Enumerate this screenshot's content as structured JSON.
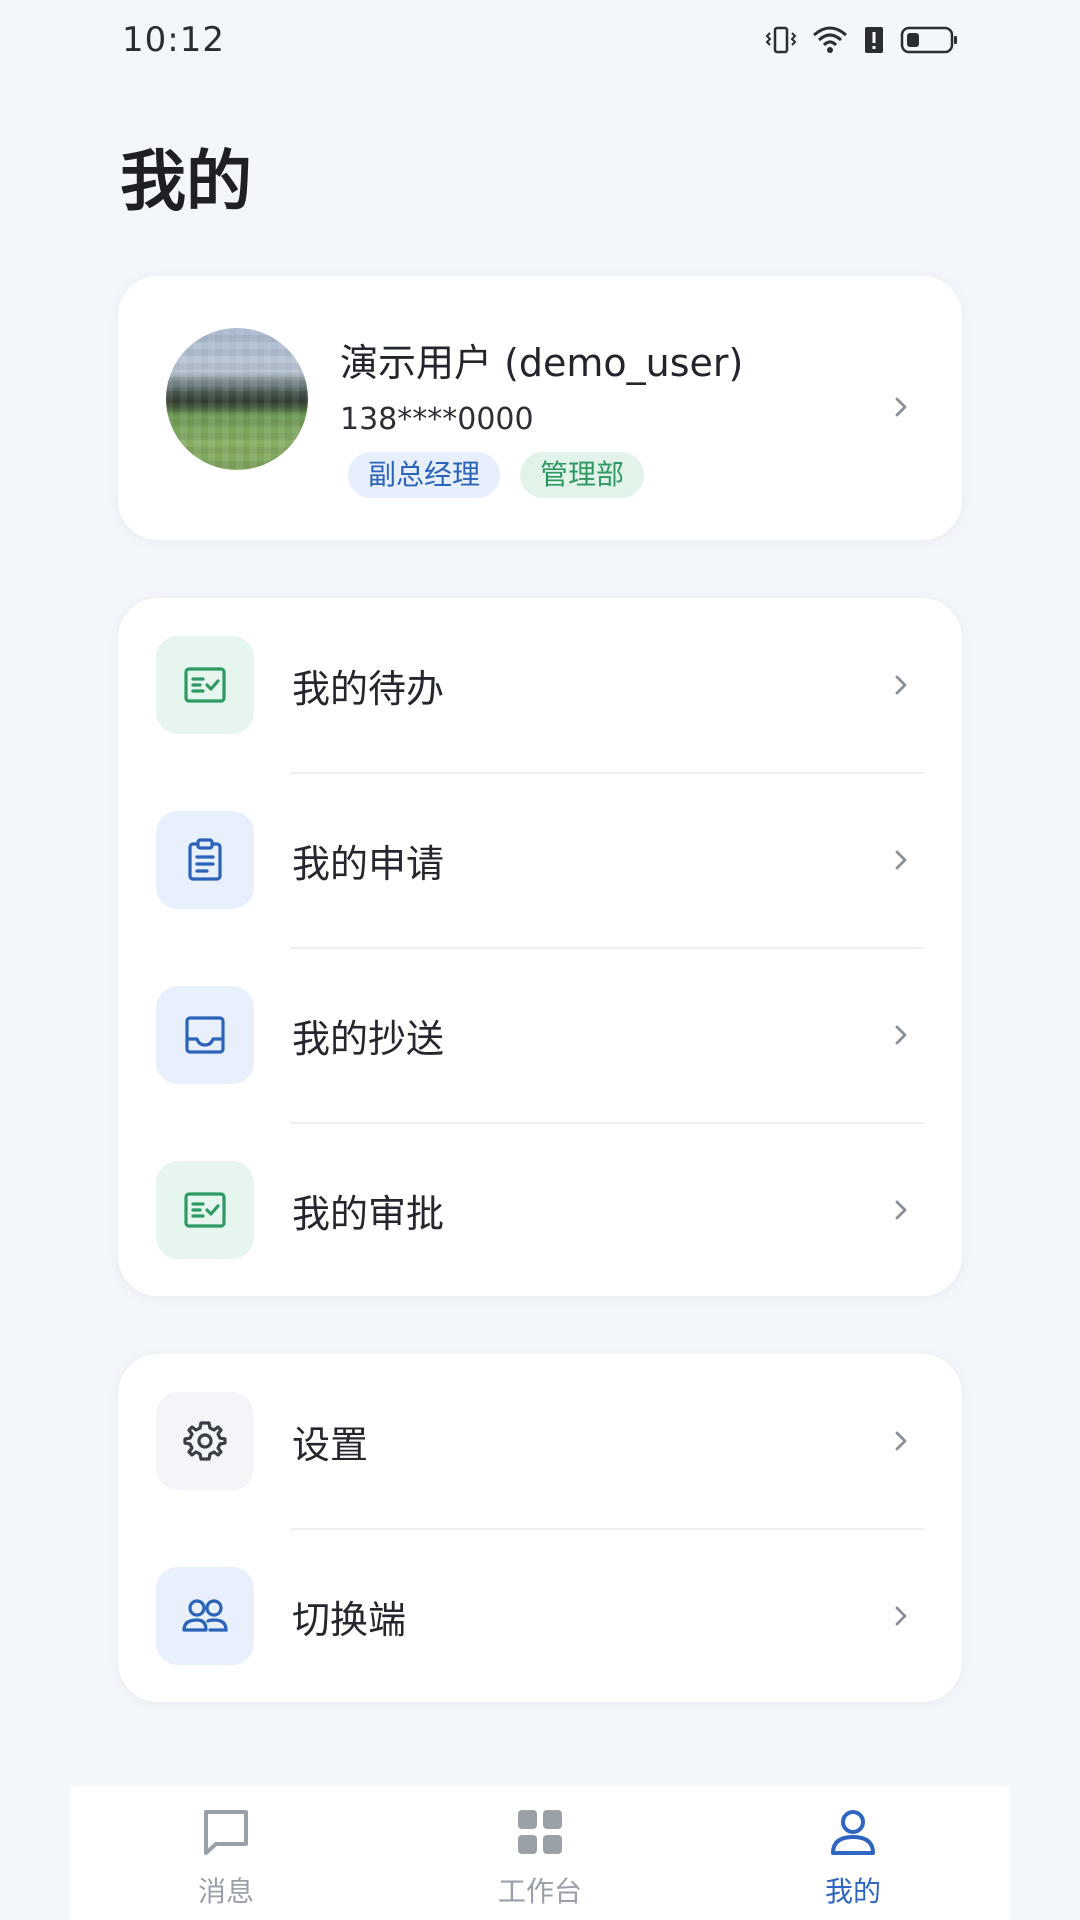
{
  "status_bar": {
    "time": "10:12"
  },
  "page": {
    "title": "我的"
  },
  "profile": {
    "name": "演示用户 (demo_user)",
    "phone": "138****0000",
    "tags": [
      "副总经理",
      "管理部"
    ]
  },
  "menu_primary": [
    {
      "label": "我的待办",
      "icon": "checklist-icon",
      "color": "#2e9a62"
    },
    {
      "label": "我的申请",
      "icon": "clipboard-icon",
      "color": "#2b63b8"
    },
    {
      "label": "我的抄送",
      "icon": "inbox-icon",
      "color": "#2b63b8"
    },
    {
      "label": "我的审批",
      "icon": "checklist-icon",
      "color": "#2e9a62"
    }
  ],
  "menu_secondary": [
    {
      "label": "设置",
      "icon": "gear-icon",
      "color": "#3a3f47"
    },
    {
      "label": "切换端",
      "icon": "users-icon",
      "color": "#2b63b8"
    }
  ],
  "bottom_nav": {
    "items": [
      {
        "label": "消息",
        "icon": "message-icon",
        "active": false
      },
      {
        "label": "工作台",
        "icon": "grid-icon",
        "active": false
      },
      {
        "label": "我的",
        "icon": "user-icon",
        "active": true
      }
    ]
  },
  "colors": {
    "accent": "#2f66c2",
    "background": "#f3f6fa",
    "tag_blue_text": "#2b63b8",
    "tag_green_text": "#2e9a62"
  }
}
